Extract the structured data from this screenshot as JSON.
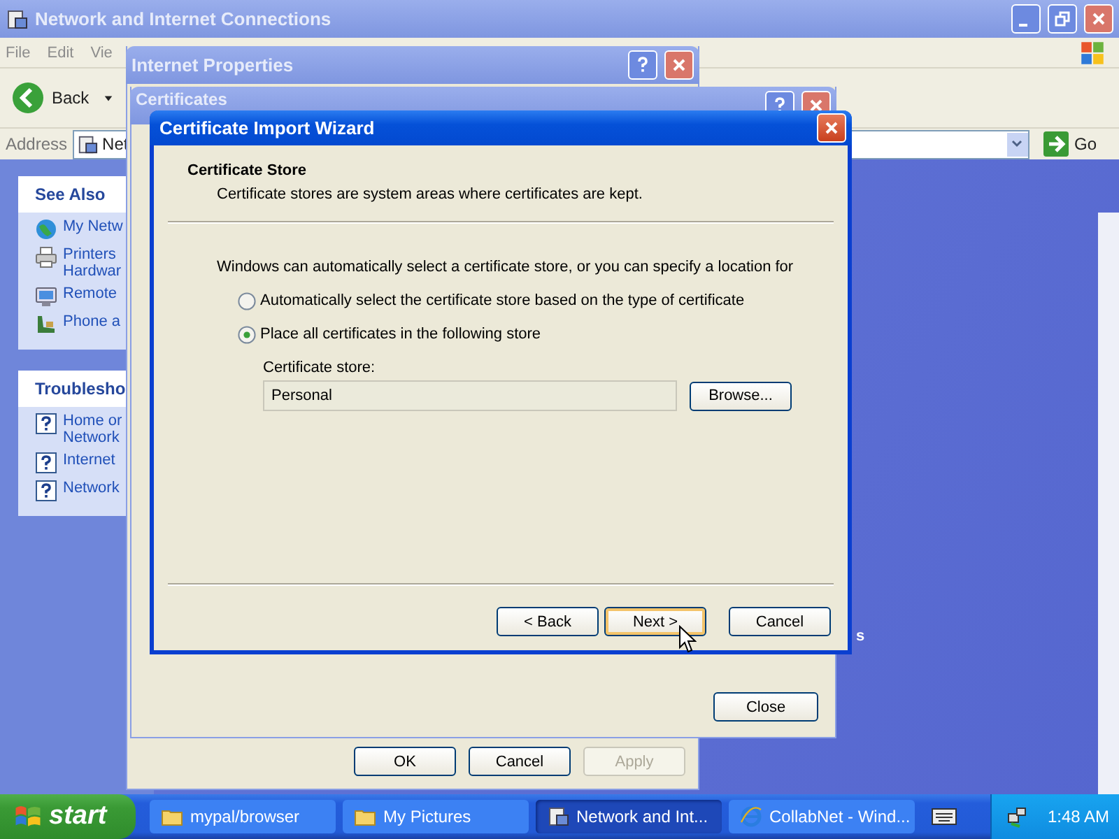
{
  "explorer": {
    "title": "Network and Internet Connections",
    "menu": [
      "File",
      "Edit",
      "Vie"
    ],
    "back": "Back",
    "address_label": "Address",
    "address_value": "Net",
    "go": "Go",
    "panels": [
      {
        "title": "See Also",
        "items": [
          {
            "kind": "globe",
            "lines": [
              "My Netw"
            ]
          },
          {
            "kind": "printer",
            "lines": [
              "Printers",
              "Hardwar"
            ]
          },
          {
            "kind": "monitor",
            "lines": [
              "Remote"
            ]
          },
          {
            "kind": "phone",
            "lines": [
              "Phone a"
            ]
          }
        ]
      },
      {
        "title": "Troublesho",
        "items": [
          {
            "kind": "help",
            "lines": [
              "Home or",
              "Network"
            ]
          },
          {
            "kind": "help",
            "lines": [
              "Internet"
            ]
          },
          {
            "kind": "help",
            "lines": [
              "Network"
            ]
          }
        ]
      }
    ],
    "content_fragment": "s"
  },
  "internet_properties": {
    "title": "Internet Properties",
    "buttons": [
      {
        "label": "OK",
        "disabled": false
      },
      {
        "label": "Cancel",
        "disabled": false
      },
      {
        "label": "Apply",
        "disabled": true
      }
    ]
  },
  "certificates": {
    "title": "Certificates",
    "close": "Close"
  },
  "wizard": {
    "title": "Certificate Import Wizard",
    "heading": "Certificate Store",
    "subheading": "Certificate stores are system areas where certificates are kept.",
    "intro": "Windows can automatically select a certificate store, or you can specify a location for",
    "options": [
      {
        "label": "Automatically select the certificate store based on the type of certificate",
        "selected": false
      },
      {
        "label": "Place all certificates in the following store",
        "selected": true
      }
    ],
    "store_label": "Certificate store:",
    "store_value": "Personal",
    "browse": "Browse...",
    "buttons": [
      {
        "label": "< Back",
        "focused": false
      },
      {
        "label": "Next >",
        "focused": true
      },
      {
        "label": "Cancel",
        "focused": false
      }
    ]
  },
  "taskbar": {
    "start": "start",
    "tasks": [
      {
        "kind": "folder",
        "label": "mypal/browser",
        "selected": false
      },
      {
        "kind": "folder",
        "label": "My Pictures",
        "selected": false
      },
      {
        "kind": "network",
        "label": "Network and Int...",
        "selected": true
      },
      {
        "kind": "browser",
        "label": "CollabNet - Wind...",
        "selected": false
      }
    ],
    "clock": "1:48 AM"
  }
}
